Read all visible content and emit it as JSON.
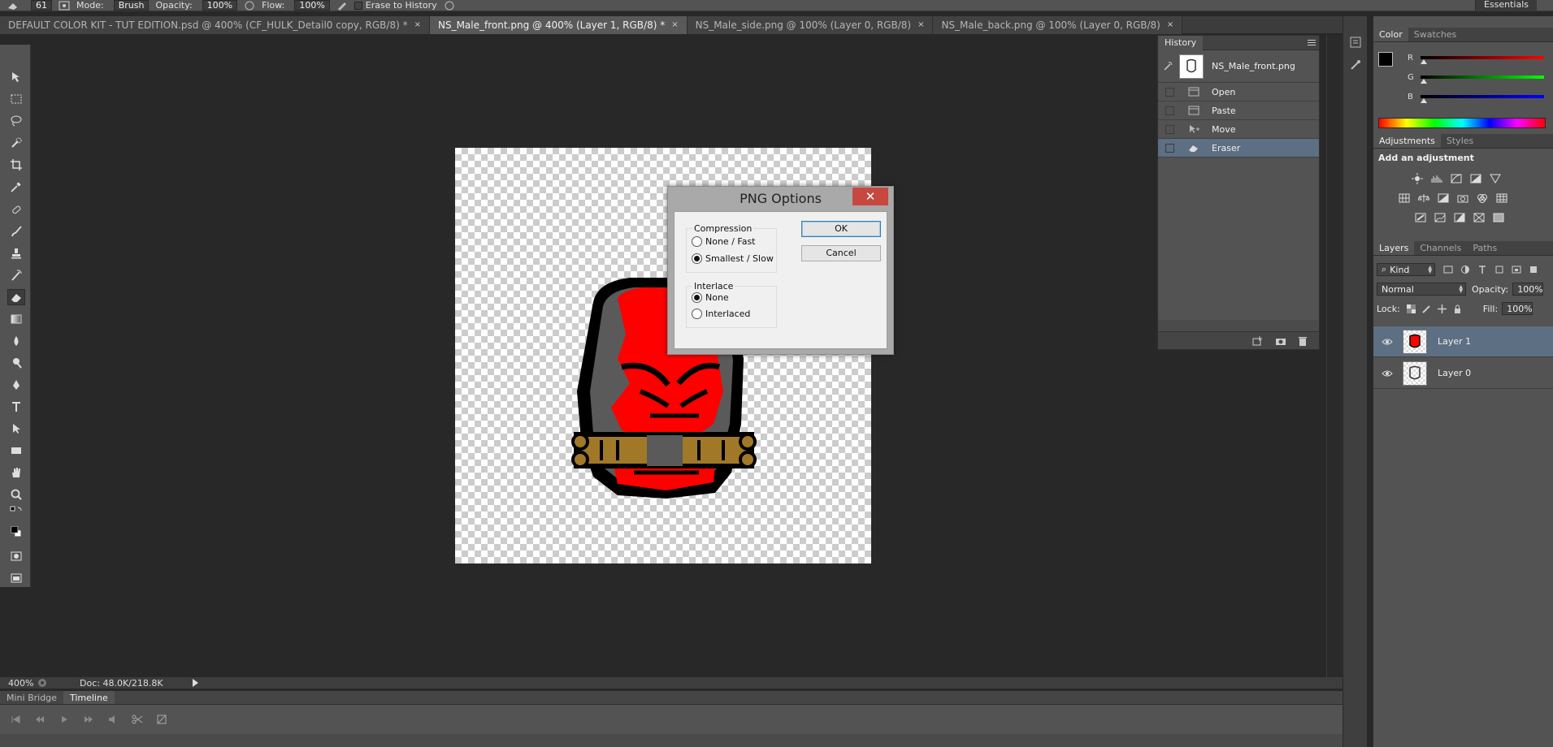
{
  "options_bar": {
    "brush_size": "61",
    "mode_label": "Mode:",
    "mode_value": "Brush",
    "opacity_label": "Opacity:",
    "opacity_value": "100%",
    "flow_label": "Flow:",
    "flow_value": "100%",
    "erase_to_history": "Erase to History",
    "workspace": "Essentials"
  },
  "doc_tabs": [
    {
      "label": "DEFAULT COLOR KIT - TUT EDITION.psd @ 400% (CF_HULK_Detail0 copy, RGB/8) *",
      "close": "×"
    },
    {
      "label": "NS_Male_front.png @ 400% (Layer 1, RGB/8) *",
      "close": "×"
    },
    {
      "label": "NS_Male_side.png @ 100% (Layer 0, RGB/8)",
      "close": "×"
    },
    {
      "label": "NS_Male_back.png @ 100% (Layer 0, RGB/8)",
      "close": "×"
    }
  ],
  "status_bar": {
    "zoom": "400%",
    "doc_info": "Doc: 48.0K/218.8K"
  },
  "bottom_panel": {
    "tabs": [
      "Mini Bridge",
      "Timeline"
    ]
  },
  "history": {
    "tab": "History",
    "snapshot": "NS_Male_front.png",
    "items": [
      "Open",
      "Paste",
      "Move",
      "Eraser"
    ]
  },
  "color_panel": {
    "tabs": [
      "Color",
      "Swatches"
    ],
    "channels": [
      {
        "name": "R",
        "value": "0",
        "color": "#ff0000"
      },
      {
        "name": "G",
        "value": "0",
        "color": "#00ff00"
      },
      {
        "name": "B",
        "value": "0",
        "color": "#0000ff"
      }
    ]
  },
  "adjustments_panel": {
    "tabs": [
      "Adjustments",
      "Styles"
    ],
    "title": "Add an adjustment"
  },
  "layers_panel": {
    "tabs": [
      "Layers",
      "Channels",
      "Paths"
    ],
    "kind": "Kind",
    "blend_mode": "Normal",
    "opacity_label": "Opacity:",
    "opacity_value": "100%",
    "lock_label": "Lock:",
    "fill_label": "Fill:",
    "fill_value": "100%",
    "layers": [
      {
        "name": "Layer 1",
        "selected": true
      },
      {
        "name": "Layer 0",
        "selected": false
      }
    ]
  },
  "png_dialog": {
    "title": "PNG Options",
    "close": "✕",
    "compression_label": "Compression",
    "compression_options": [
      "None / Fast",
      "Smallest / Slow"
    ],
    "interlace_label": "Interlace",
    "interlace_options": [
      "None",
      "Interlaced"
    ],
    "ok": "OK",
    "cancel": "Cancel"
  },
  "colors": {
    "accent_selection": "#5d6f82",
    "dialog_close": "#c7483f",
    "character_red": "#ff0000",
    "character_gray": "#5a5a5a",
    "bone": "#a07828"
  }
}
